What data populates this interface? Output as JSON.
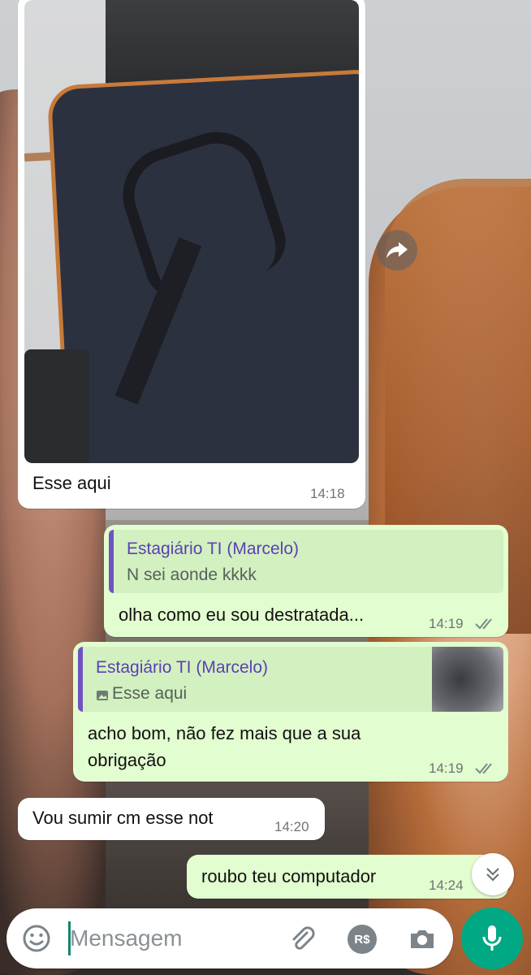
{
  "messages": [
    {
      "caption": "Esse aqui",
      "time": "14:18"
    },
    {
      "quote_author": "Estagiário TI (Marcelo)",
      "quote_text": "N sei aonde kkkk",
      "text": "olha como eu sou destratada...",
      "time": "14:19"
    },
    {
      "quote_author": "Estagiário TI (Marcelo)",
      "quote_text": "Esse aqui",
      "text_line1": "acho bom, não fez mais que a sua",
      "text_line2": "obrigação",
      "time": "14:19"
    },
    {
      "text": "Vou sumir cm esse not",
      "time": "14:20"
    },
    {
      "text": "roubo teu computador",
      "time": "14:24"
    }
  ],
  "composer": {
    "placeholder": "Mensagem",
    "icons": [
      "emoji-icon",
      "attach-icon",
      "payment-icon",
      "camera-icon",
      "mic-icon"
    ],
    "payment_label": "R$"
  },
  "colors": {
    "incoming": "#ffffff",
    "outgoing": "#e2fdcf",
    "quote_author": "#5a41b5",
    "accent": "#00a884"
  }
}
